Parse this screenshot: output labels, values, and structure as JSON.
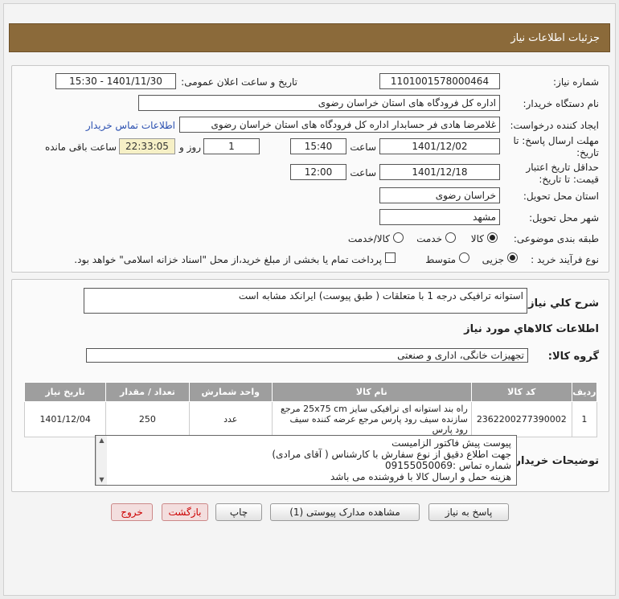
{
  "header": {
    "title": "جزئیات اطلاعات نیاز"
  },
  "form": {
    "need_number_label": "شماره نیاز:",
    "need_number": "1101001578000464",
    "announce_label": "تاریخ و ساعت اعلان عمومی:",
    "announce_value": "1401/11/30 - 15:30",
    "buyer_org_label": "نام دستگاه خریدار:",
    "buyer_org": "اداره کل فرودگاه های استان خراسان رضوی",
    "creator_label": "ایجاد کننده درخواست:",
    "creator": "غلامرضا هادی فر حسابدار اداره کل فرودگاه های استان خراسان رضوی",
    "contact_link": "اطلاعات تماس خریدار",
    "deadline_label_1": "مهلت ارسال پاسخ: تا",
    "deadline_label_2": "تاریخ:",
    "deadline_date": "1401/12/02",
    "time_label": "ساعت",
    "deadline_time": "15:40",
    "days_count": "1",
    "days_label": "روز و",
    "remaining_time": "22:33:05",
    "remaining_label": "ساعت باقی مانده",
    "validity_label_1": "حداقل تاریخ اعتبار",
    "validity_label_2": "قیمت: تا تاریخ:",
    "validity_date": "1401/12/18",
    "validity_time": "12:00",
    "province_label": "استان محل تحویل:",
    "province": "خراسان رضوی",
    "city_label": "شهر محل تحویل:",
    "city": "مشهد",
    "category_label": "طبقه بندی موضوعی:",
    "category_options": [
      "کالا",
      "خدمت",
      "کالا/خدمت"
    ],
    "category_selected": "کالا",
    "process_label": "نوع فرآیند خرید :",
    "process_options": [
      "جزیی",
      "متوسط"
    ],
    "process_selected": "جزیی",
    "payment_note": "پرداخت تمام یا بخشی از مبلغ خرید،از محل \"اسناد خزانه اسلامی\" خواهد بود."
  },
  "summary": {
    "label": "شرح کلي نياز:",
    "text": "استوانه ترافیکی درجه 1 با متعلقات ( طبق پیوست) ایرانکد مشابه است"
  },
  "goods": {
    "section_title": "اطلاعات کالاهاي مورد نياز",
    "group_label": "گروه کالا:",
    "group_value": "تجهیزات خانگی، اداری و صنعتی",
    "columns": [
      "ردیف",
      "کد کالا",
      "نام کالا",
      "واحد شمارش",
      "تعداد / مقدار",
      "تاریخ نیاز"
    ],
    "rows": [
      {
        "row": "1",
        "code": "2362200277390002",
        "name": "راه بند استوانه ای ترافیکی سایز 25x75 cm مرجع سازنده سیف رود پارس مرجع عرضه کننده سیف رود پارس",
        "unit": "عدد",
        "qty": "250",
        "date": "1401/12/04"
      }
    ]
  },
  "buyer_notes": {
    "label": "توضیحات خریدار:",
    "lines": [
      "پیوست پیش فاکتور الزامیست",
      "جهت اطلاع دقیق از نوع سفارش با کارشناس  ( آقای مرادی)",
      "شماره تماس :09155050069",
      "هزینه حمل و ارسال کالا با فروشنده می باشد"
    ]
  },
  "buttons": {
    "reply": "پاسخ به نیاز",
    "attachments": "مشاهده مدارک پیوستی (1)",
    "print": "چاپ",
    "back": "بازگشت",
    "exit": "خروج"
  }
}
